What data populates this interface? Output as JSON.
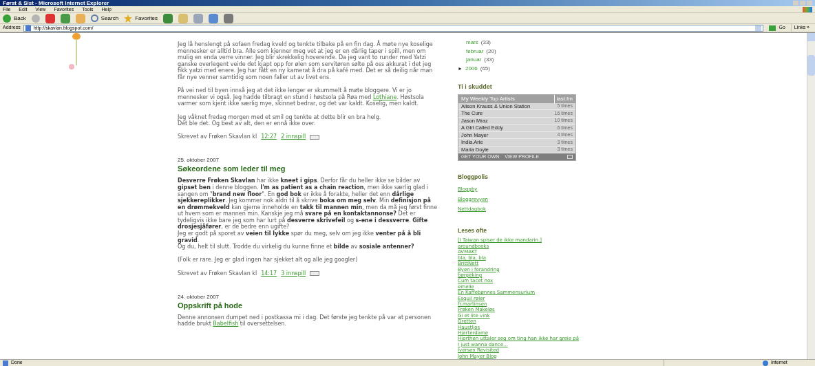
{
  "window": {
    "title": "Først & Sist - Microsoft Internet Explorer"
  },
  "menu": [
    "File",
    "Edit",
    "View",
    "Favorites",
    "Tools",
    "Help"
  ],
  "toolbar": {
    "back": "Back",
    "search": "Search",
    "favorites": "Favorites"
  },
  "address": {
    "label": "Address",
    "value": "http://skavlan.blogspot.com/",
    "go": "Go",
    "links": "Links »"
  },
  "posts": [
    {
      "paragraphs": [
        {
          "lines": [
            "Jeg lå henslengt på sofaen fredag kveld og tenkte tilbake på en fin dag. Å møte nye koselige mennesker er alltid bra. Alle som kjenner meg vet at jeg er en dårlig taper i spill, men om mulig en enda verre vinner. Jeg blir skrekkelig hoverende. Da jeg vant to runder med Yatzi ganske overlegent veide det kjapt opp for ølen som servitøren sølte på oss akkurat i det jeg fikk yatzi med enere. Jeg har fått en ny kamerat å dra på kafé med. Det er så deilig når man får nye venner samtidig som noen faller ut av livet ens."
          ]
        },
        {
          "lines": [
            [
              {
                "text": "På vei ned til byen innså jeg at det ikke lenger er skummelt å møte bloggere. Vi er jo mennesker vi også. Jeg hadde tilbragt en stund i høstsola på Røa med "
              },
              {
                "text": "Lothiane",
                "kind": "link"
              },
              {
                "text": ". Høstsola varmer som kjent ikke særlig mye, skinnet bedrar, og det var kaldt. Koselig, men kaldt."
              }
            ]
          ]
        },
        {
          "lines": [
            "Jeg våknet fredag morgen med et smil og tenkte at dette blir en bra helg.",
            "Dét ble det. Og best av alt, den er ennå ikke over."
          ]
        }
      ],
      "byline": "Skrevet av Frøken Skavlan kl",
      "time": "12:27",
      "comments": "2 innspill"
    },
    {
      "date": "25. oktober 2007",
      "title": "Søkeordene som leder til meg",
      "paragraphs": [
        {
          "lines": [
            "**Desverre Frøken Skavlan** har ikke **kneet i gips**. Derfor får du heller ikke se bilder av **gipset ben** i denne bloggen. **I'm as patient as a chain reaction**, men ikke særlig glad i sangen om \"**brand new floor**\". En **god bok** er ikke å forakte, heller det enn **dårlige sjekkereplikker**. Jeg kommer nok aldri til å skrive **boka om meg selv**. Min **definisjon på en drømmekveld** kan gjerne inneholde en **takk til mannen min**, men da må jeg først finne ut hvem som er mannen min. Kanskje jeg må **svare på en kontaktannonse?** Det er tydeligvis ikke bare jeg som har lurt på **desverre skrivefeil** og **s-ene i dessverre**. **Gifte drosjesjåfører**, er de bedre enn ugifte?",
            "Jeg er godt på sporet av **veien til lykke** spør du meg, selv om jeg ikke **venter på å bli gravid**.",
            "Og du, helt til slutt. Trodde du virkelig du kunne finne et **bilde** av **sosiale antenner?**"
          ]
        },
        {
          "lines": [
            "(Folk er rare. Jeg er glad ingen har sjekket alt og alle jeg googler)"
          ]
        }
      ],
      "byline": "Skrevet av Frøken Skavlan kl",
      "time": "14:17",
      "comments": "3 innspill"
    },
    {
      "date": "24. oktober 2007",
      "title": "Oppskrift på hode",
      "paragraphs": [
        {
          "lines": [
            [
              {
                "text": "Denne annonsen dumpet ned i postkassa mi i dag. Det første jeg tenkte på var at personen hadde brukt "
              },
              {
                "text": "Babelfish",
                "kind": "link"
              },
              {
                "text": " til oversettelsen."
              }
            ]
          ]
        }
      ]
    }
  ],
  "archive": [
    {
      "kind": "month",
      "label": "mars",
      "count": "(33)"
    },
    {
      "kind": "month",
      "label": "februar",
      "count": "(20)"
    },
    {
      "kind": "month",
      "label": "januar",
      "count": "(33)"
    },
    {
      "kind": "year",
      "label": "2006",
      "count": "(65)",
      "toggle": "►"
    }
  ],
  "lastfm": {
    "title": "Ti i skuddet",
    "header": "My Weekly Top Artists",
    "logo": "last.fm",
    "rows": [
      {
        "artist": "Alison Krauss & Union Station",
        "plays": "5 times"
      },
      {
        "artist": "The Cure",
        "plays": "16 times"
      },
      {
        "artist": "Jason Mraz",
        "plays": "10 times"
      },
      {
        "artist": "A Girl Called Eddy",
        "plays": "6 times"
      },
      {
        "artist": "John Mayer",
        "plays": "4 times"
      },
      {
        "artist": "India.Arie",
        "plays": "3 times"
      },
      {
        "artist": "Maria Doyle",
        "plays": "3 times"
      }
    ],
    "footer": [
      "GET YOUR OWN",
      "VIEW PROFILE"
    ]
  },
  "sections": [
    {
      "title": "Bloggpolis",
      "kind": "spaced",
      "links": [
        "Bloggby",
        "Bloggrevyen",
        "Nettdagbok"
      ]
    },
    {
      "title": "Leses ofte",
      "kind": "dense",
      "links": [
        "[I Taiwan spiser de ikke mandarin.]",
        "aroundbooks",
        "AVMAKT",
        "bla, bla, bla",
        "BrittNett",
        "Byen i forandring",
        "børgeking",
        "Cum tacet nox",
        "emelie",
        "En Kaffebønnes Sammensurium",
        "Esquil røler",
        "fr.martinsen",
        "Frøken Makeløs",
        "Gi et lite vink",
        "Gretten",
        "Haustljos",
        "Hjerterdame",
        "Hjorthen uttaler seg om ting han ikke har greie på",
        "I just wanna dance...",
        "Iversen Revisited",
        "John Mayer Blog"
      ]
    }
  ],
  "status_bar": {
    "text": "Done",
    "zone": "Internet"
  }
}
